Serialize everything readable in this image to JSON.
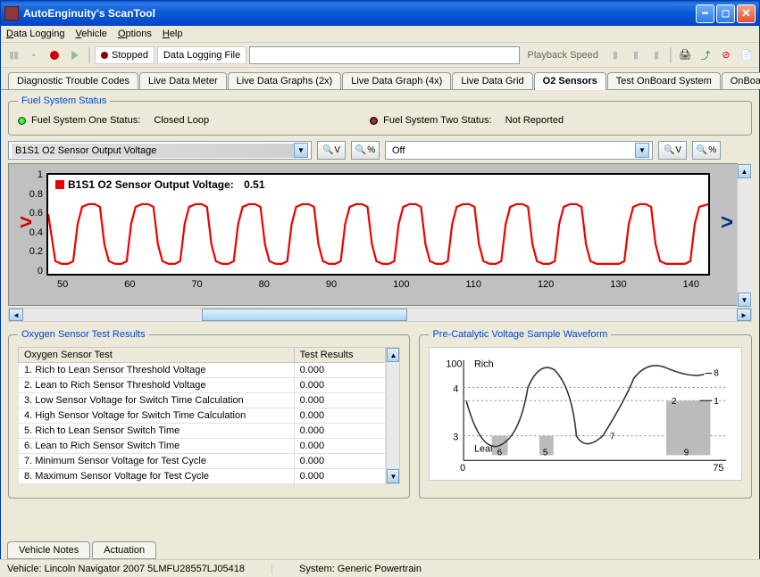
{
  "window": {
    "title": "AutoEnginuity's ScanTool"
  },
  "menu": {
    "data": "Data Logging",
    "vehicle": "Vehicle",
    "options": "Options",
    "help": "Help"
  },
  "toolbar": {
    "stopped": "Stopped",
    "file_label": "Data Logging File",
    "playback": "Playback Speed"
  },
  "tabs": {
    "items": [
      "Diagnostic Trouble Codes",
      "Live Data Meter",
      "Live Data Graphs (2x)",
      "Live Data Graph (4x)",
      "Live Data Grid",
      "O2 Sensors",
      "Test OnBoard System",
      "OnBoard Te"
    ]
  },
  "fss": {
    "legend": "Fuel System Status",
    "one_label": "Fuel System One Status:",
    "one_value": "Closed Loop",
    "two_label": "Fuel System Two Status:",
    "two_value": "Not Reported"
  },
  "selectors": {
    "left": "B1S1 O2 Sensor Output Voltage",
    "right": "Off",
    "zoomV": "V",
    "zoomPct": "%"
  },
  "chart_data": {
    "type": "line",
    "series_label": "B1S1 O2 Sensor Output Voltage:",
    "current_value": "0.51",
    "y_ticks": [
      "1",
      "0.8",
      "0.6",
      "0.4",
      "0.2",
      "0"
    ],
    "x_ticks": [
      "50",
      "60",
      "70",
      "80",
      "90",
      "100",
      "110",
      "120",
      "130",
      "140"
    ],
    "ylim": [
      0,
      1
    ],
    "xlim": [
      45,
      142
    ],
    "note": "oscillating lean/rich O2 sensor waveform approx 0.1–0.7 V"
  },
  "results": {
    "legend": "Oxygen Sensor Test Results",
    "col_test": "Oxygen Sensor Test",
    "col_result": "Test Results",
    "rows": [
      {
        "t": "1. Rich to Lean Sensor Threshold Voltage",
        "r": "0.000"
      },
      {
        "t": "2. Lean to Rich Sensor Threshold Voltage",
        "r": "0.000"
      },
      {
        "t": "3. Low Sensor Voltage for Switch Time Calculation",
        "r": "0.000"
      },
      {
        "t": "4. High Sensor Voltage for Switch Time Calculation",
        "r": "0.000"
      },
      {
        "t": "5. Rich to Lean Sensor Switch Time",
        "r": "0.000"
      },
      {
        "t": "6. Lean to Rich Sensor Switch Time",
        "r": "0.000"
      },
      {
        "t": "7. Minimum Sensor Voltage for Test Cycle",
        "r": "0.000"
      },
      {
        "t": "8. Maximum Sensor Voltage for Test Cycle",
        "r": "0.000"
      }
    ]
  },
  "precat": {
    "legend": "Pre-Catalytic Voltage Sample Waveform",
    "rich": "Rich",
    "lean": "Lean",
    "y100": "100",
    "y4": "4",
    "y3": "3",
    "x0": "0",
    "x75": "75",
    "m1": "1",
    "m2": "2",
    "m5": "5",
    "m6": "6",
    "m7": "7",
    "m8": "8",
    "m9": "9"
  },
  "bottom_tabs": {
    "notes": "Vehicle Notes",
    "actuation": "Actuation"
  },
  "status": {
    "vehicle": "Vehicle: Lincoln  Navigator  2007  5LMFU28557LJ05418",
    "system": "System: Generic Powertrain"
  }
}
